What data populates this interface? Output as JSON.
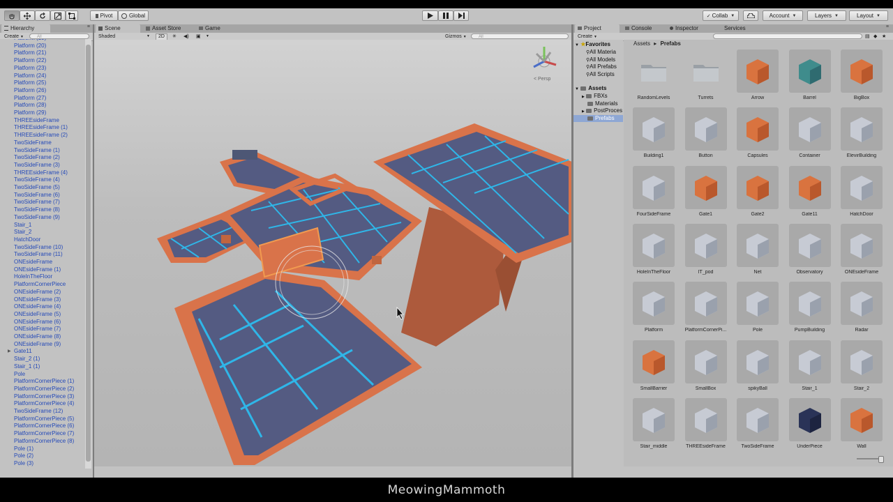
{
  "toolbar": {
    "pivot": "Pivot",
    "global": "Global",
    "collab": "Collab",
    "account": "Account",
    "layers": "Layers",
    "layout": "Layout"
  },
  "hierarchy": {
    "tab": "Hierarchy",
    "create": "Create",
    "search_placeholder": "All",
    "items": [
      "Platform (19)",
      "Platform (20)",
      "Platform (21)",
      "Platform (22)",
      "Platform (23)",
      "Platform (24)",
      "Platform (25)",
      "Platform (26)",
      "Platform (27)",
      "Platform (28)",
      "Platform (29)",
      "THREEsideFrame",
      "THREEsideFrame (1)",
      "THREEsideFrame (2)",
      "TwoSideFrame",
      "TwoSideFrame (1)",
      "TwoSideFrame (2)",
      "TwoSideFrame (3)",
      "THREEsideFrame (4)",
      "TwoSideFrame (4)",
      "TwoSideFrame (5)",
      "TwoSideFrame (6)",
      "TwoSideFrame (7)",
      "TwoSideFrame (8)",
      "TwoSideFrame (9)",
      "Stair_1",
      "Stair_2",
      "HatchDoor",
      "TwoSideFrame (10)",
      "TwoSideFrame (11)",
      "ONEsideFrame",
      "ONEsideFrame (1)",
      "HoleInTheFloor",
      "PlatformCornerPiece",
      "ONEsideFrame (2)",
      "ONEsideFrame (3)",
      "ONEsideFrame (4)",
      "ONEsideFrame (5)",
      "ONEsideFrame (6)",
      "ONEsideFrame (7)",
      "ONEsideFrame (8)",
      "ONEsideFrame (9)",
      "Gate11",
      "Stair_2 (1)",
      "Stair_1 (1)",
      "Pole",
      "PlatformCornerPiece (1)",
      "PlatformCornerPiece (2)",
      "PlatformCornerPiece (3)",
      "PlatformCornerPiece (4)",
      "TwoSideFrame (12)",
      "PlatformCornerPiece (5)",
      "PlatformCornerPiece (6)",
      "PlatformCornerPiece (7)",
      "PlatformCornerPiece (8)",
      "Pole (1)",
      "Pole (2)",
      "Pole (3)"
    ]
  },
  "scene": {
    "tabs": [
      "Scene",
      "Asset Store",
      "Game"
    ],
    "shaded": "Shaded",
    "mode2d": "2D",
    "gizmos": "Gizmos",
    "search_placeholder": "All",
    "persp": "Persp"
  },
  "project": {
    "tabs": [
      "Project",
      "Console",
      "Inspector",
      "Services"
    ],
    "create": "Create",
    "favorites": {
      "label": "Favorites",
      "items": [
        "All Materia",
        "All Models",
        "All Prefabs",
        "All Scripts"
      ]
    },
    "assets_root": {
      "label": "Assets",
      "items": [
        "FBXs",
        "Materials",
        "PostProces",
        "Prefabs"
      ]
    },
    "breadcrumb": [
      "Assets",
      "Prefabs"
    ],
    "assets": [
      {
        "name": "RandomLevels",
        "kind": "folder"
      },
      {
        "name": "Turrets",
        "kind": "folder"
      },
      {
        "name": "Arrow",
        "kind": "orange"
      },
      {
        "name": "Barrel",
        "kind": "teal"
      },
      {
        "name": "BigBox",
        "kind": "orange"
      },
      {
        "name": "Building1",
        "kind": "grey"
      },
      {
        "name": "Button",
        "kind": "grey"
      },
      {
        "name": "Capsules",
        "kind": "orange"
      },
      {
        "name": "Container",
        "kind": "grey"
      },
      {
        "name": "ElevirBuilding",
        "kind": "grey"
      },
      {
        "name": "FourSideFrame",
        "kind": "grey"
      },
      {
        "name": "Gate1",
        "kind": "orange"
      },
      {
        "name": "Gate2",
        "kind": "orange"
      },
      {
        "name": "Gate11",
        "kind": "orange"
      },
      {
        "name": "HatchDoor",
        "kind": "grey"
      },
      {
        "name": "HoleInTheFloor",
        "kind": "grey"
      },
      {
        "name": "IT_pod",
        "kind": "grey"
      },
      {
        "name": "Net",
        "kind": "grey"
      },
      {
        "name": "Observatory",
        "kind": "grey"
      },
      {
        "name": "ONEsideFrame",
        "kind": "grey"
      },
      {
        "name": "Platform",
        "kind": "grey"
      },
      {
        "name": "PlatformCornerPi...",
        "kind": "grey"
      },
      {
        "name": "Pole",
        "kind": "grey"
      },
      {
        "name": "PumpBuilding",
        "kind": "grey"
      },
      {
        "name": "Radar",
        "kind": "grey"
      },
      {
        "name": "SmallBarrier",
        "kind": "orange"
      },
      {
        "name": "SmallBox",
        "kind": "grey"
      },
      {
        "name": "spikyBall",
        "kind": "grey"
      },
      {
        "name": "Stair_1",
        "kind": "grey"
      },
      {
        "name": "Stair_2",
        "kind": "grey"
      },
      {
        "name": "Stair_middle",
        "kind": "grey"
      },
      {
        "name": "THREEsideFrame",
        "kind": "grey"
      },
      {
        "name": "TwoSideFrame",
        "kind": "grey"
      },
      {
        "name": "UnderPiece",
        "kind": "navy"
      },
      {
        "name": "Wall",
        "kind": "orange"
      }
    ]
  },
  "watermark": "MeowingMammoth",
  "colors": {
    "editor_bg": "#c2c2c2",
    "hierarchy_link": "#2449b8",
    "frame_orange": "#d9734a",
    "floor_blue": "#545b82",
    "neon": "#2fb6e8"
  }
}
